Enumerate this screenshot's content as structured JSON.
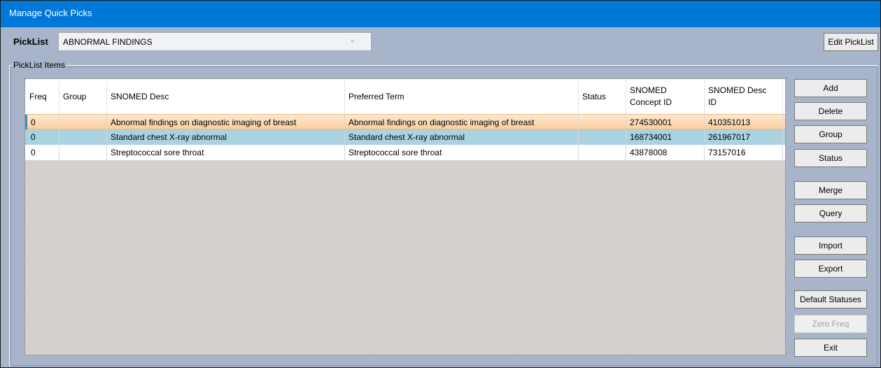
{
  "window": {
    "title": "Manage Quick Picks"
  },
  "picklist": {
    "label": "PickList",
    "selected": "ABNORMAL FINDINGS",
    "edit_button": "Edit PickList"
  },
  "group": {
    "label": "PickList Items"
  },
  "table": {
    "columns": [
      "Freq",
      "Group",
      "SNOMED Desc",
      "Preferred Term",
      "Status",
      "SNOMED\nConcept ID",
      "SNOMED Desc\nID"
    ],
    "rows": [
      {
        "freq": "0",
        "group": "",
        "snomed_desc": "Abnormal findings on diagnostic imaging of breast",
        "preferred_term": "Abnormal findings on diagnostic imaging of breast",
        "status": "",
        "concept_id": "274530001",
        "desc_id": "410351013",
        "state": "highlighted"
      },
      {
        "freq": "0",
        "group": "",
        "snomed_desc": "Standard chest X-ray abnormal",
        "preferred_term": "Standard chest X-ray abnormal",
        "status": "",
        "concept_id": "168734001",
        "desc_id": "261967017",
        "state": "selected"
      },
      {
        "freq": "0",
        "group": "",
        "snomed_desc": "Streptococcal sore throat",
        "preferred_term": "Streptococcal sore throat",
        "status": "",
        "concept_id": "43878008",
        "desc_id": "73157016",
        "state": "normal"
      }
    ]
  },
  "buttons": {
    "add": "Add",
    "delete": "Delete",
    "group": "Group",
    "status": "Status",
    "merge": "Merge",
    "query": "Query",
    "import": "Import",
    "export": "Export",
    "default_statuses": "Default Statuses",
    "zero_freq": "Zero Freq",
    "exit": "Exit"
  },
  "colors": {
    "titlebar": "#0078d7",
    "window_bg": "#a7b4c9",
    "grid_bg": "#d5d0cb",
    "selected_row": "#a9d3e0",
    "highlight_row": "#fbcf9c"
  },
  "icons": {
    "dropdown": "chevron-down-icon"
  }
}
